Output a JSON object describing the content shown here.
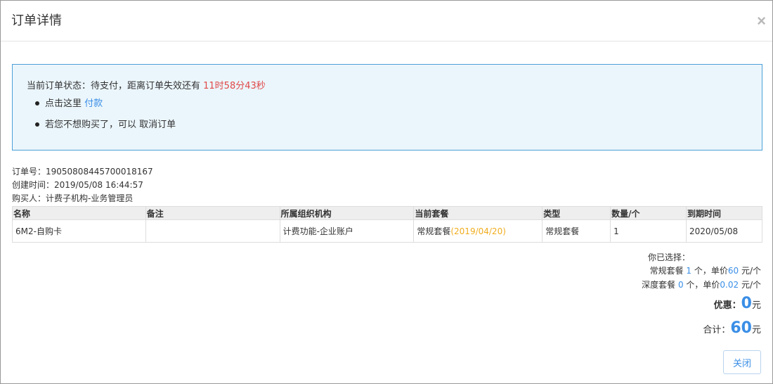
{
  "modal": {
    "title": "订单详情",
    "close_symbol": "×"
  },
  "status": {
    "prefix": "当前订单状态：待支付，距离订单失效还有 ",
    "countdown": "11时58分43秒",
    "pay_prefix": "点击这里 ",
    "pay_link": "付款",
    "cancel_prefix": "若您不想购买了，可以 ",
    "cancel_link": "取消订单"
  },
  "order_info": {
    "number": "订单号：1905080844570001816­7",
    "created": "创建时间：2019/05/08 16:44:57",
    "buyer": "购买人：计费子机构-业务管理员"
  },
  "table": {
    "headers": [
      "名称",
      "备注",
      "所属组织机构",
      "当前套餐",
      "类型",
      "数量/个",
      "到期时间"
    ],
    "rows": [
      {
        "name": "6M2-自购卡",
        "note": "",
        "org": "计费功能-企业账户",
        "package": "常规套餐",
        "package_date": "(2019/04/20)",
        "type": "常规套餐",
        "qty": "1",
        "expire": "2020/05/08"
      }
    ]
  },
  "summary": {
    "selected_label": "你已选择：",
    "line1_a": "常规套餐 ",
    "line1_count": "1",
    "line1_b": " 个，单价",
    "line1_price": "60",
    "line1_c": " 元/个",
    "line2_a": "深度套餐 ",
    "line2_count": "0",
    "line2_b": " 个，单价",
    "line2_price": "0.02",
    "line2_c": " 元/个",
    "discount_label": "优惠：",
    "discount_value": "0",
    "total_label": "合计：",
    "total_value": "60",
    "unit": "元"
  },
  "footer": {
    "close_label": "关闭"
  },
  "colors": {
    "accent": "#3a8ee6",
    "countdown": "#e04848",
    "package_date": "#f0ad1e",
    "status_bg": "#ebf6fc",
    "status_border": "#4c9fd9"
  }
}
